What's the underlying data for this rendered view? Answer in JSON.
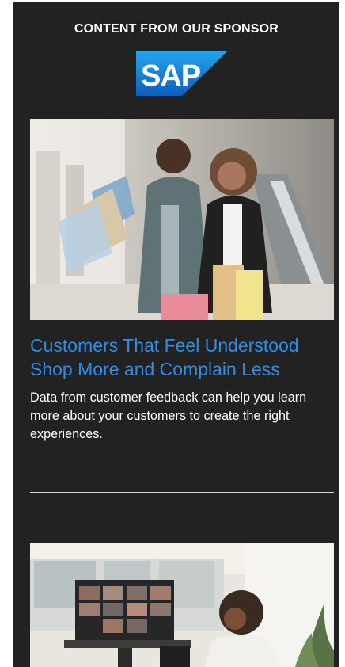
{
  "sponsor": {
    "label": "CONTENT FROM OUR SPONSOR",
    "logo_text": "SAP",
    "logo_color": "#1670d1"
  },
  "article": {
    "headline": "Customers That Feel Understood Shop More and Complain Less",
    "summary": "Data from customer feedback can help you learn more about your customers to create the right experiences.",
    "headline_color": "#2f8fe8"
  },
  "images": {
    "hero": "shopping couple with bags in mall photo",
    "second": "video conference meeting photo"
  },
  "colors": {
    "background": "#222222",
    "text": "#ffffff"
  }
}
